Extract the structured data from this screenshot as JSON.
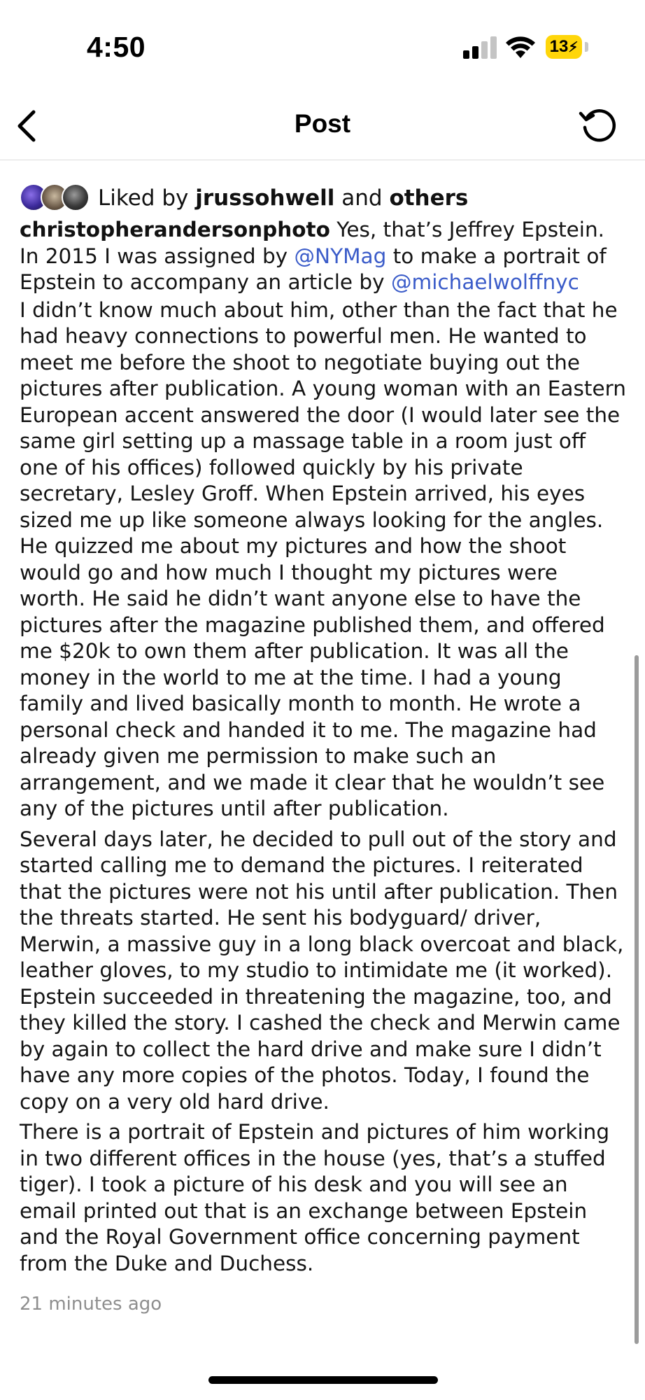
{
  "status_bar": {
    "time": "4:50",
    "battery_level": "13"
  },
  "header": {
    "title": "Post"
  },
  "likes": {
    "prefix": "Liked by",
    "first_user": "jrussohwell",
    "connector": "and",
    "others": "others"
  },
  "post": {
    "username": "christopherandersonphoto",
    "p1_text_a": " Yes, that’s Jeffrey Epstein. In 2015 I was assigned by ",
    "mention_1": "@NYMag",
    "p1_text_b": " to make a portrait of Epstein to accompany an article by ",
    "mention_2": "@michaelwolffnyc",
    "paragraph_2": "I didn’t know much about him, other than the fact that he had heavy connections to powerful men. He wanted to meet me before the shoot to negotiate buying out the pictures after publication. A young woman with an Eastern European accent answered the door (I would later see the same girl setting up a massage table in a room just off one of his offices) followed quickly by his private secretary, Lesley Groff. When Epstein arrived, his eyes sized me up like someone always looking for the angles. He quizzed me about my pictures and how the shoot would go and how much I thought my pictures were worth. He said he didn’t want anyone else to have the pictures after the magazine published them, and offered me $20k to own them after publication. It was all the money in the world to me at the time. I had a young family and lived basically month to month. He wrote a personal check and handed it to me. The magazine had already given me permission to make such an arrangement, and we made it clear that he wouldn’t see any of the pictures until after publication.",
    "paragraph_3": "Several days later, he decided to pull out of the story and started calling me to demand the pictures. I reiterated that the pictures were not his until after publication. Then the threats started. He sent his bodyguard/ driver, Merwin, a massive guy in a long black overcoat and black, leather gloves, to my studio to intimidate me (it worked). Epstein succeeded in threatening the magazine, too, and they killed the story. I cashed the check and Merwin came by again to collect the hard drive and make sure I didn’t have any more copies of the photos. Today, I found the copy on a very old hard drive.",
    "paragraph_4": "There is a portrait of Epstein and pictures of him working in two different offices in the house (yes, that’s a stuffed tiger). I took a picture of his desk and you will see an email printed out that is an exchange between Epstein and the Royal Government office concerning payment from the Duke and Duchess.",
    "timestamp": "21 minutes ago"
  },
  "colors": {
    "mention": "#3b5cc9",
    "battery": "#ffd60a",
    "timestamp": "#8e8e8e"
  },
  "icons": {
    "back": "chevron-left-icon",
    "refresh": "refresh-icon",
    "signal": "cellular-signal-icon",
    "wifi": "wifi-icon",
    "battery": "battery-charging-icon"
  }
}
